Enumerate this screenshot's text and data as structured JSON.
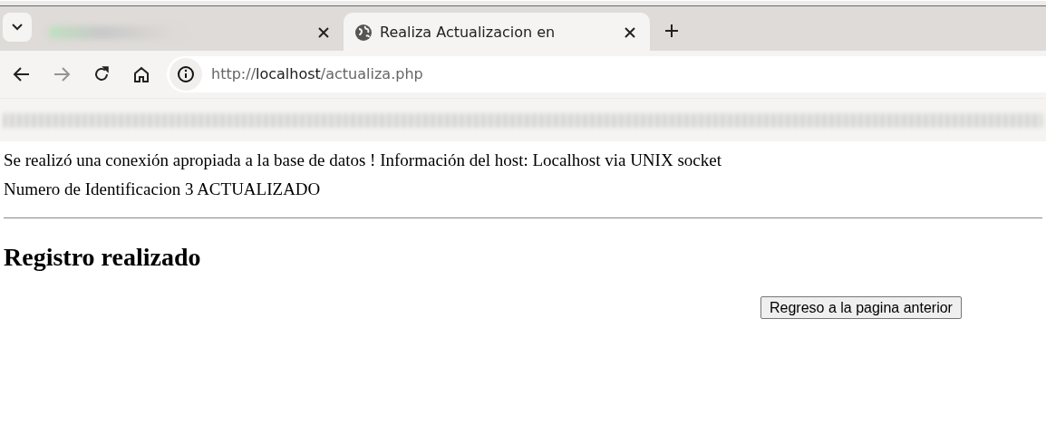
{
  "browser": {
    "tabs": [
      {
        "title_blurred": true,
        "selected": false
      },
      {
        "title": "Realiza Actualizacion en",
        "selected": true
      }
    ],
    "address": {
      "scheme": "http://",
      "host": "localhost",
      "path": "/actualiza.php"
    },
    "nav": {
      "back_disabled": false,
      "forward_disabled": true
    }
  },
  "page": {
    "messages": [
      "Se realizó una conexión apropiada a la base de datos ! Información del host: Localhost via UNIX socket",
      "Numero de Identificacion 3 ACTUALIZADO"
    ],
    "heading": "Registro realizado",
    "button": "Regreso a la pagina anterior"
  }
}
